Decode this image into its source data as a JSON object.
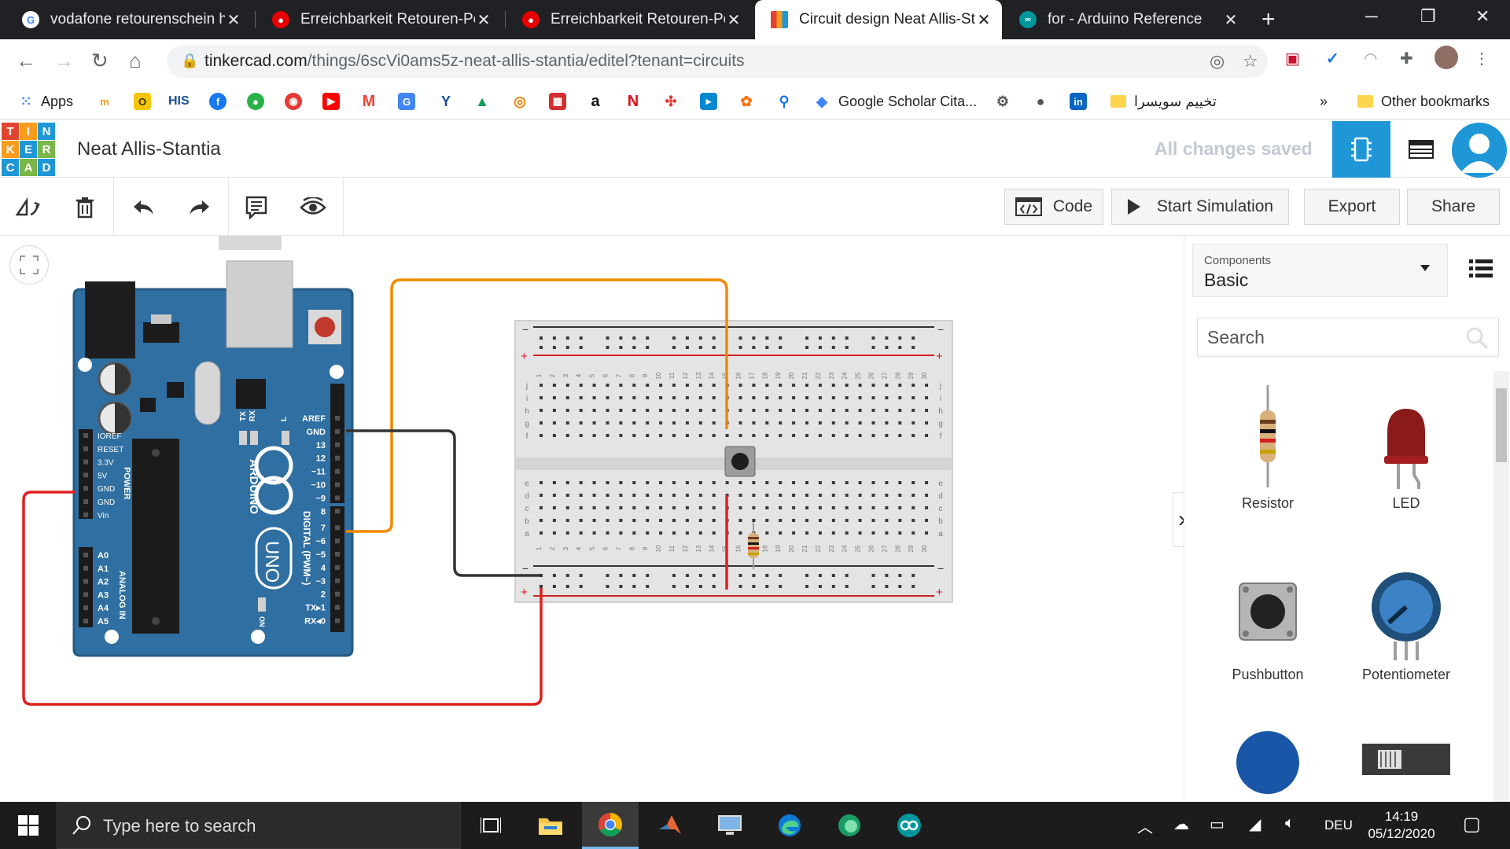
{
  "browser": {
    "tabs": [
      {
        "title": "vodafone retourenschein ha",
        "favicon": "google-icon",
        "active": false
      },
      {
        "title": "Erreichbarkeit Retouren-Por",
        "favicon": "vodafone-icon",
        "active": false
      },
      {
        "title": "Erreichbarkeit Retouren-Por",
        "favicon": "vodafone-icon",
        "active": false
      },
      {
        "title": "Circuit design Neat Allis-Sta",
        "favicon": "tinkercad-icon",
        "active": true
      },
      {
        "title": "for - Arduino Reference",
        "favicon": "arduino-icon",
        "active": false
      }
    ],
    "url_host": "tinkercad.com",
    "url_path": "/things/6scVi0ams5z-neat-allis-stantia/editel?tenant=circuits",
    "bookmarks": {
      "apps": "Apps",
      "his": "HIS",
      "scholar": "Google Scholar Cita...",
      "rtl_folder": "تخييم سويسرا",
      "more": "»",
      "other": "Other bookmarks"
    }
  },
  "app": {
    "logo_letters": [
      "T",
      "I",
      "N",
      "K",
      "E",
      "R",
      "C",
      "A",
      "D"
    ],
    "design_name": "Neat Allis-Stantia",
    "save_status": "All changes saved",
    "toolbar": {
      "code": "Code",
      "start_simulation": "Start Simulation",
      "export": "Export",
      "share": "Share"
    },
    "panel": {
      "category_label": "Components",
      "category_value": "Basic",
      "search_placeholder": "Search",
      "components": [
        {
          "name": "Resistor",
          "icon": "resistor-icon"
        },
        {
          "name": "LED",
          "icon": "led-icon"
        },
        {
          "name": "Pushbutton",
          "icon": "pushbutton-icon"
        },
        {
          "name": "Potentiometer",
          "icon": "potentiometer-icon"
        }
      ]
    },
    "arduino": {
      "brand": "ARDUINO",
      "model": "UNO",
      "power_label": "POWER",
      "analog_label": "ANALOG IN",
      "digital_label": "DIGITAL (PWM~)",
      "on_label": "ON",
      "tx_label": "TX",
      "rx_label": "RX",
      "l_label": "L",
      "power_pins": [
        "IOREF",
        "RESET",
        "3.3V",
        "5V",
        "GND",
        "GND",
        "Vin"
      ],
      "analog_pins": [
        "A0",
        "A1",
        "A2",
        "A3",
        "A4",
        "A5"
      ],
      "digital_pins": [
        "AREF",
        "GND",
        "13",
        "12",
        "~11",
        "~10",
        "~9",
        "8",
        "7",
        "~6",
        "~5",
        "4",
        "~3",
        "2",
        "TX▸1",
        "RX◂0"
      ]
    },
    "breadboard": {
      "row_letters_top": [
        "j",
        "i",
        "h",
        "g",
        "f"
      ],
      "row_letters_bottom": [
        "e",
        "d",
        "c",
        "b",
        "a"
      ],
      "columns": 30,
      "minus": "−",
      "plus": "+"
    },
    "wire_colors": {
      "orange": "#f08a00",
      "black": "#333333",
      "red": "#e0201e"
    }
  },
  "taskbar": {
    "search_placeholder": "Type here to search",
    "language": "DEU",
    "time": "14:19",
    "date": "05/12/2020"
  }
}
